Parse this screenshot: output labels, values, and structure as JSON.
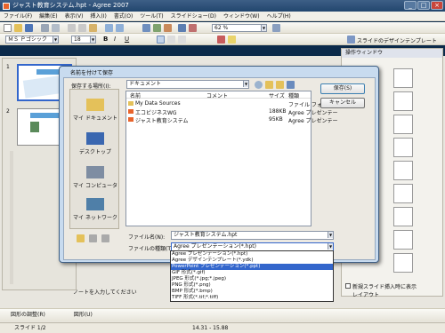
{
  "window": {
    "title": "ジャスト教育システム.hpt - Agree 2007"
  },
  "menu": [
    "ファイル(F)",
    "編集(E)",
    "表示(V)",
    "挿入(I)",
    "書式(O)",
    "ツール(T)",
    "スライドショー(D)",
    "ウィンドウ(W)",
    "ヘルプ(H)"
  ],
  "toolbar": {
    "font": "ＭＳ Ｐゴシック",
    "size": "18",
    "zoom": "62 %",
    "design_template": "スライドのデザインテンプレート"
  },
  "right_panel": {
    "title": "操作ウィンドウ",
    "checkbox_label": "新規スライド挿入時に表示",
    "tab": "レイアウト"
  },
  "slides": [
    "1",
    "2"
  ],
  "notes_placeholder": "ノートを入力してください",
  "drawbar": {
    "draw_label": "図形の調整(R)",
    "shapes_label": "図形(U)"
  },
  "status": {
    "slide": "スライド 1/2",
    "coords": "14.31 - 15.88"
  },
  "dialog": {
    "title": "名前を付けて保存",
    "location_label": "保存する場所(I):",
    "location_value": "ドキュメント",
    "places": [
      "マイ ドキュメント",
      "デスクトップ",
      "マイ コンピュータ",
      "マイ ネットワーク"
    ],
    "columns": [
      "名前",
      "コメント",
      "サイズ",
      "種類"
    ],
    "files": [
      {
        "name": "My Data Sources",
        "comment": "",
        "size": "",
        "type": "ファイル フォルダ"
      },
      {
        "name": "エコビジネスWG",
        "comment": "",
        "size": "188KB",
        "type": "Agree プレゼンテー"
      },
      {
        "name": "ジャスト教育システム",
        "comment": "",
        "size": "95KB",
        "type": "Agree プレゼンテー"
      }
    ],
    "filename_label": "ファイル名(N):",
    "filename_value": "ジャスト教育システム.hpt",
    "filetype_label": "ファイルの種類(T):",
    "filetype_value": "Agree プレゼンテーション(*.hpt)",
    "save_button": "保存(S)",
    "cancel_button": "キャンセル",
    "filetype_options": [
      "Agree プレゼンテーション(*.hpt)",
      "Agree デザインテンプレート(*.ydk)",
      "PowerPoint プレゼンテーション(*.ppt)",
      "GIF 形式(*.gif)",
      "JPEG 形式(*.jpg;*.jpeg)",
      "PNG 形式(*.png)",
      "BMP 形式(*.bmp)",
      "TIFF 形式(*.tif;*.tiff)"
    ]
  }
}
